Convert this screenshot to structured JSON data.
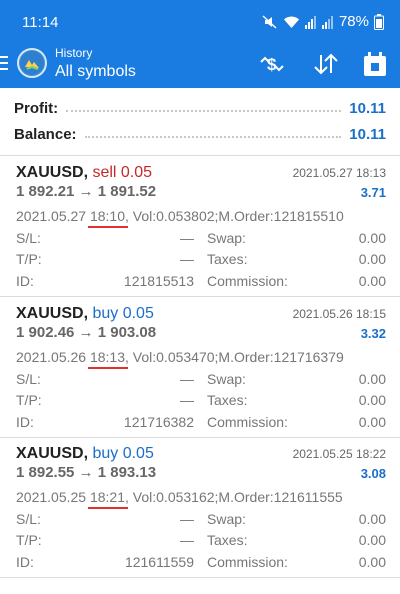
{
  "status_bar": {
    "time": "11:14",
    "battery": "78%",
    "icons": [
      "mute-icon",
      "wifi-icon",
      "signal-icon",
      "signal-icon",
      "battery-icon"
    ]
  },
  "app_bar": {
    "subtitle": "History",
    "title": "All symbols",
    "icons": [
      "menu-icon",
      "app-logo",
      "currency-sort-icon",
      "sort-icon",
      "calendar-icon"
    ],
    "color": "#1a7be0"
  },
  "summary": {
    "profit_label": "Profit:",
    "profit_value": "10.11",
    "balance_label": "Balance:",
    "balance_value": "10.11"
  },
  "deals": [
    {
      "symbol": "XAUUSD,",
      "side": "sell 0.05",
      "datetime": "2021.05.27 18:13",
      "prices": "1 892.21 → 1 891.52",
      "profit": "3.71",
      "info_date": "2021.05.27",
      "info_time": "18:10",
      "info_rest": ", Vol:0.053802;M.Order:121815510",
      "sl_label": "S/L:",
      "sl_value": "—",
      "swap_label": "Swap:",
      "swap_value": "0.00",
      "tp_label": "T/P:",
      "tp_value": "—",
      "taxes_label": "Taxes:",
      "taxes_value": "0.00",
      "id_label": "ID:",
      "id_value": "121815513",
      "commission_label": "Commission:",
      "commission_value": "0.00"
    },
    {
      "symbol": "XAUUSD,",
      "side": "buy 0.05",
      "datetime": "2021.05.26 18:15",
      "prices": "1 902.46 → 1 903.08",
      "profit": "3.32",
      "info_date": "2021.05.26",
      "info_time": "18:13",
      "info_rest": ", Vol:0.053470;M.Order:121716379",
      "sl_label": "S/L:",
      "sl_value": "—",
      "swap_label": "Swap:",
      "swap_value": "0.00",
      "tp_label": "T/P:",
      "tp_value": "—",
      "taxes_label": "Taxes:",
      "taxes_value": "0.00",
      "id_label": "ID:",
      "id_value": "121716382",
      "commission_label": "Commission:",
      "commission_value": "0.00"
    },
    {
      "symbol": "XAUUSD,",
      "side": "buy 0.05",
      "datetime": "2021.05.25 18:22",
      "prices": "1 892.55 → 1 893.13",
      "profit": "3.08",
      "info_date": "2021.05.25",
      "info_time": "18:21",
      "info_rest": ", Vol:0.053162;M.Order:121611555",
      "sl_label": "S/L:",
      "sl_value": "—",
      "swap_label": "Swap:",
      "swap_value": "0.00",
      "tp_label": "T/P:",
      "tp_value": "—",
      "taxes_label": "Taxes:",
      "taxes_value": "0.00",
      "id_label": "ID:",
      "id_value": "121611559",
      "commission_label": "Commission:",
      "commission_value": "0.00"
    }
  ],
  "colors": {
    "profit_blue": "#1a6fc8",
    "sell_red": "#c62828",
    "annotation_red": "#e03030"
  }
}
